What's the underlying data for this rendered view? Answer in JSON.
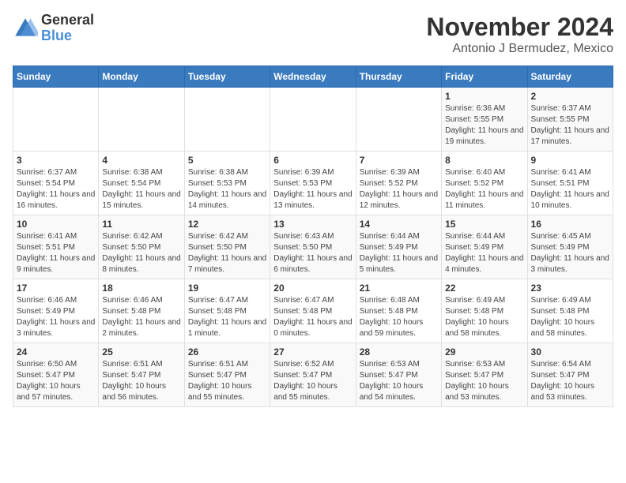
{
  "logo": {
    "general": "General",
    "blue": "Blue"
  },
  "title": "November 2024",
  "subtitle": "Antonio J Bermudez, Mexico",
  "days_of_week": [
    "Sunday",
    "Monday",
    "Tuesday",
    "Wednesday",
    "Thursday",
    "Friday",
    "Saturday"
  ],
  "weeks": [
    [
      {
        "day": "",
        "info": ""
      },
      {
        "day": "",
        "info": ""
      },
      {
        "day": "",
        "info": ""
      },
      {
        "day": "",
        "info": ""
      },
      {
        "day": "",
        "info": ""
      },
      {
        "day": "1",
        "info": "Sunrise: 6:36 AM\nSunset: 5:55 PM\nDaylight: 11 hours and 19 minutes."
      },
      {
        "day": "2",
        "info": "Sunrise: 6:37 AM\nSunset: 5:55 PM\nDaylight: 11 hours and 17 minutes."
      }
    ],
    [
      {
        "day": "3",
        "info": "Sunrise: 6:37 AM\nSunset: 5:54 PM\nDaylight: 11 hours and 16 minutes."
      },
      {
        "day": "4",
        "info": "Sunrise: 6:38 AM\nSunset: 5:54 PM\nDaylight: 11 hours and 15 minutes."
      },
      {
        "day": "5",
        "info": "Sunrise: 6:38 AM\nSunset: 5:53 PM\nDaylight: 11 hours and 14 minutes."
      },
      {
        "day": "6",
        "info": "Sunrise: 6:39 AM\nSunset: 5:53 PM\nDaylight: 11 hours and 13 minutes."
      },
      {
        "day": "7",
        "info": "Sunrise: 6:39 AM\nSunset: 5:52 PM\nDaylight: 11 hours and 12 minutes."
      },
      {
        "day": "8",
        "info": "Sunrise: 6:40 AM\nSunset: 5:52 PM\nDaylight: 11 hours and 11 minutes."
      },
      {
        "day": "9",
        "info": "Sunrise: 6:41 AM\nSunset: 5:51 PM\nDaylight: 11 hours and 10 minutes."
      }
    ],
    [
      {
        "day": "10",
        "info": "Sunrise: 6:41 AM\nSunset: 5:51 PM\nDaylight: 11 hours and 9 minutes."
      },
      {
        "day": "11",
        "info": "Sunrise: 6:42 AM\nSunset: 5:50 PM\nDaylight: 11 hours and 8 minutes."
      },
      {
        "day": "12",
        "info": "Sunrise: 6:42 AM\nSunset: 5:50 PM\nDaylight: 11 hours and 7 minutes."
      },
      {
        "day": "13",
        "info": "Sunrise: 6:43 AM\nSunset: 5:50 PM\nDaylight: 11 hours and 6 minutes."
      },
      {
        "day": "14",
        "info": "Sunrise: 6:44 AM\nSunset: 5:49 PM\nDaylight: 11 hours and 5 minutes."
      },
      {
        "day": "15",
        "info": "Sunrise: 6:44 AM\nSunset: 5:49 PM\nDaylight: 11 hours and 4 minutes."
      },
      {
        "day": "16",
        "info": "Sunrise: 6:45 AM\nSunset: 5:49 PM\nDaylight: 11 hours and 3 minutes."
      }
    ],
    [
      {
        "day": "17",
        "info": "Sunrise: 6:46 AM\nSunset: 5:49 PM\nDaylight: 11 hours and 3 minutes."
      },
      {
        "day": "18",
        "info": "Sunrise: 6:46 AM\nSunset: 5:48 PM\nDaylight: 11 hours and 2 minutes."
      },
      {
        "day": "19",
        "info": "Sunrise: 6:47 AM\nSunset: 5:48 PM\nDaylight: 11 hours and 1 minute."
      },
      {
        "day": "20",
        "info": "Sunrise: 6:47 AM\nSunset: 5:48 PM\nDaylight: 11 hours and 0 minutes."
      },
      {
        "day": "21",
        "info": "Sunrise: 6:48 AM\nSunset: 5:48 PM\nDaylight: 10 hours and 59 minutes."
      },
      {
        "day": "22",
        "info": "Sunrise: 6:49 AM\nSunset: 5:48 PM\nDaylight: 10 hours and 58 minutes."
      },
      {
        "day": "23",
        "info": "Sunrise: 6:49 AM\nSunset: 5:48 PM\nDaylight: 10 hours and 58 minutes."
      }
    ],
    [
      {
        "day": "24",
        "info": "Sunrise: 6:50 AM\nSunset: 5:47 PM\nDaylight: 10 hours and 57 minutes."
      },
      {
        "day": "25",
        "info": "Sunrise: 6:51 AM\nSunset: 5:47 PM\nDaylight: 10 hours and 56 minutes."
      },
      {
        "day": "26",
        "info": "Sunrise: 6:51 AM\nSunset: 5:47 PM\nDaylight: 10 hours and 55 minutes."
      },
      {
        "day": "27",
        "info": "Sunrise: 6:52 AM\nSunset: 5:47 PM\nDaylight: 10 hours and 55 minutes."
      },
      {
        "day": "28",
        "info": "Sunrise: 6:53 AM\nSunset: 5:47 PM\nDaylight: 10 hours and 54 minutes."
      },
      {
        "day": "29",
        "info": "Sunrise: 6:53 AM\nSunset: 5:47 PM\nDaylight: 10 hours and 53 minutes."
      },
      {
        "day": "30",
        "info": "Sunrise: 6:54 AM\nSunset: 5:47 PM\nDaylight: 10 hours and 53 minutes."
      }
    ]
  ]
}
